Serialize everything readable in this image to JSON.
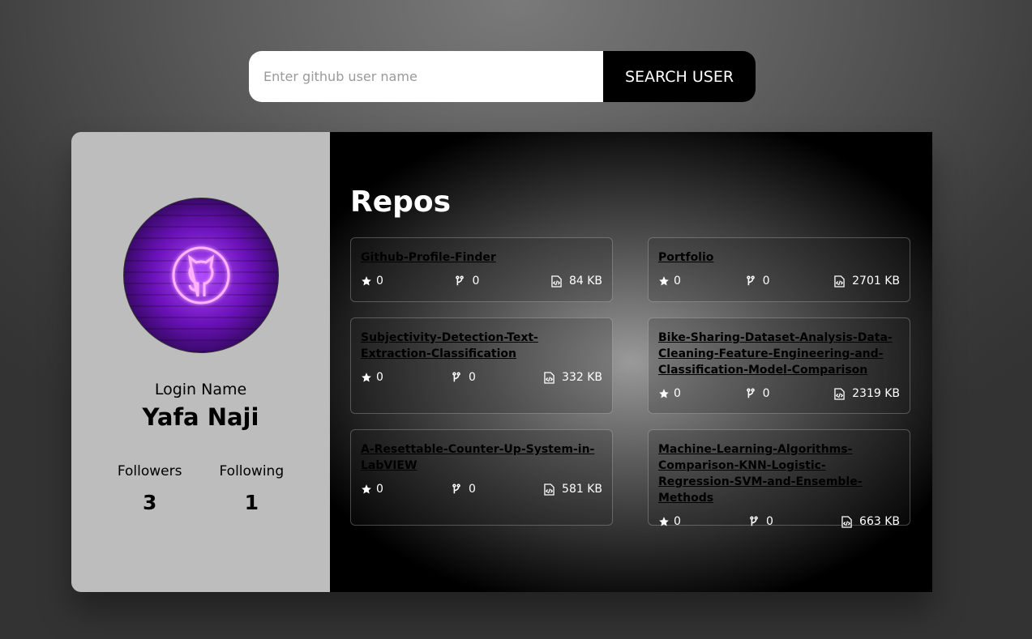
{
  "search": {
    "placeholder": "Enter github user name",
    "button_label": "SEARCH USER"
  },
  "profile": {
    "login_label": "Login Name",
    "login_name": "Yafa Naji",
    "followers_label": "Followers",
    "followers": "3",
    "following_label": "Following",
    "following": "1"
  },
  "repos": {
    "title": "Repos",
    "items": [
      {
        "name": "Github-Profile-Finder",
        "stars": "0",
        "forks": "0",
        "size": "84 KB"
      },
      {
        "name": "Portfolio",
        "stars": "0",
        "forks": "0",
        "size": "2701 KB"
      },
      {
        "name": "Subjectivity-Detection-Text-Extraction-Classification",
        "stars": "0",
        "forks": "0",
        "size": "332 KB"
      },
      {
        "name": "Bike-Sharing-Dataset-Analysis-Data-Cleaning-Feature-Engineering-and-Classification-Model-Comparison",
        "stars": "0",
        "forks": "0",
        "size": "2319 KB"
      },
      {
        "name": "A-Resettable-Counter-Up-System-in-LabVIEW",
        "stars": "0",
        "forks": "0",
        "size": "581 KB"
      },
      {
        "name": "Machine-Learning-Algorithms-Comparison-KNN-Logistic-Regression-SVM-and-Ensemble-Methods",
        "stars": "0",
        "forks": "0",
        "size": "663 KB"
      }
    ]
  },
  "icons": {
    "avatar": "github-neon-logo-icon",
    "star": "star-icon",
    "fork": "fork-icon",
    "size": "file-code-icon"
  },
  "colors": {
    "search_button": "#000000",
    "profile_bg": "#bdbdbd",
    "avatar_glow": "#b24cff"
  }
}
